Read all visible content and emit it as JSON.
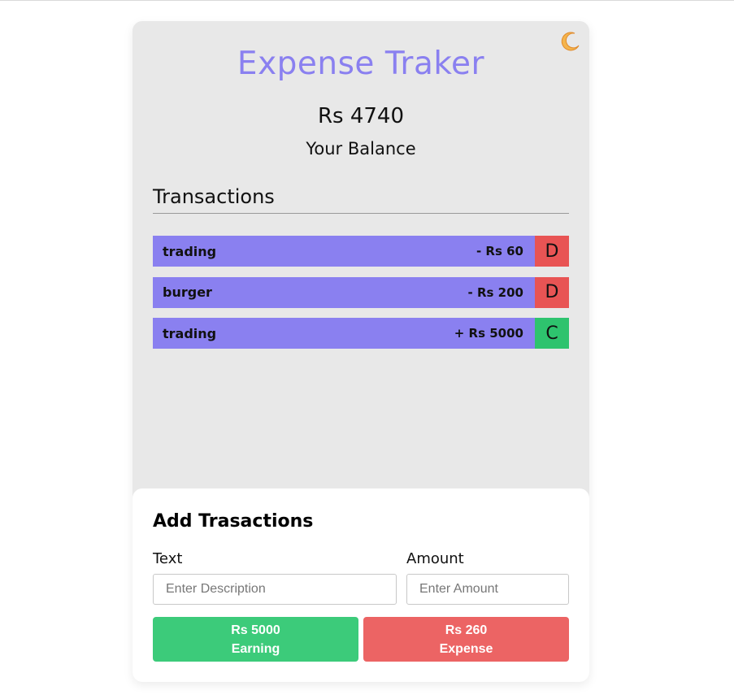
{
  "app": {
    "title": "Expense Traker",
    "theme_toggle_icon": "moon-icon"
  },
  "balance": {
    "amount": "Rs 4740",
    "label": "Your Balance"
  },
  "transactions": {
    "heading": "Transactions",
    "items": [
      {
        "text": "trading",
        "amount": "- Rs 60",
        "type": "D",
        "type_color": "#e85454"
      },
      {
        "text": "burger",
        "amount": "- Rs 200",
        "type": "D",
        "type_color": "#e85454"
      },
      {
        "text": "trading",
        "amount": "+ Rs 5000",
        "type": "C",
        "type_color": "#2ec36e"
      }
    ]
  },
  "form": {
    "title": "Add Trasactions",
    "text_label": "Text",
    "text_placeholder": "Enter Description",
    "text_value": "",
    "amount_label": "Amount",
    "amount_placeholder": "Enter Amount",
    "amount_value": "",
    "earning_button": {
      "amount": "Rs 5000",
      "label": "Earning",
      "color": "#3ccb7a"
    },
    "expense_button": {
      "amount": "Rs 260",
      "label": "Expense",
      "color": "#ec6464"
    }
  },
  "colors": {
    "accent": "#8a80f0",
    "card_bg": "#e8e8e8",
    "debit": "#e85454",
    "credit": "#2ec36e"
  }
}
